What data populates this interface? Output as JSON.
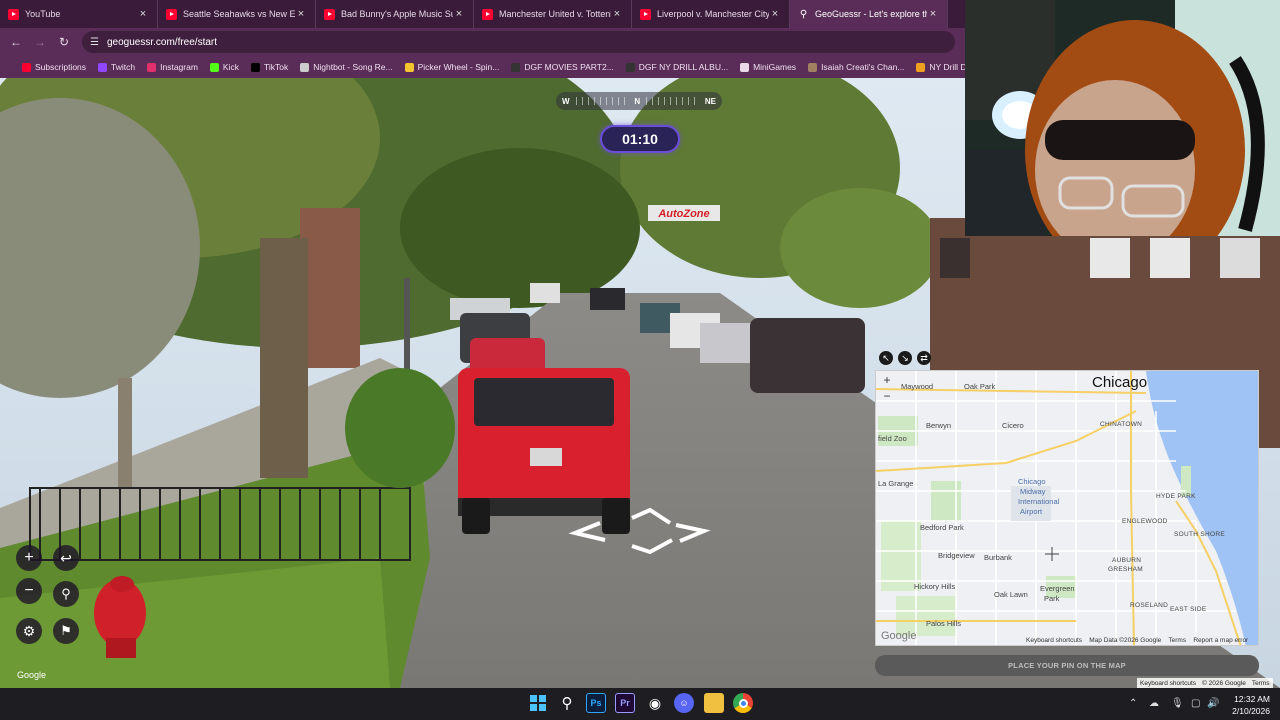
{
  "browser": {
    "tabs": [
      {
        "title": "YouTube",
        "icon": "youtube-icon"
      },
      {
        "title": "Seattle Seahawks vs New Engla",
        "icon": "youtube-icon"
      },
      {
        "title": "Bad Bunny's Apple Music Supe",
        "icon": "youtube-icon"
      },
      {
        "title": "Manchester United v. Tottenhai",
        "icon": "youtube-icon"
      },
      {
        "title": "Liverpool v. Manchester City | P",
        "icon": "youtube-icon"
      },
      {
        "title": "GeoGuessr - Let's explore the w",
        "icon": "geoguessr-icon",
        "active": true
      }
    ],
    "url": "geoguessr.com/free/start",
    "bookmarks": [
      {
        "label": "Subscriptions",
        "color": "#ff0033"
      },
      {
        "label": "Twitch",
        "color": "#9146ff"
      },
      {
        "label": "Instagram",
        "color": "#e1306c"
      },
      {
        "label": "Kick",
        "color": "#53fc18"
      },
      {
        "label": "TikTok",
        "color": "#000000"
      },
      {
        "label": "Nightbot - Song Re...",
        "color": "#cccccc"
      },
      {
        "label": "Picker Wheel - Spin...",
        "color": "#f4c430"
      },
      {
        "label": "DGF MOVIES PART2...",
        "color": "#333333"
      },
      {
        "label": "DGF NY DRILL ALBU...",
        "color": "#333333"
      },
      {
        "label": "MiniGames",
        "color": "#e8d8e8"
      },
      {
        "label": "Isaiah Creati's Chan...",
        "color": "#a08060"
      },
      {
        "label": "NY Drill Deads Qu",
        "color": "#f0a020"
      }
    ]
  },
  "game": {
    "compass": {
      "left": "W",
      "center": "N",
      "right": "NE"
    },
    "timer": "01:10",
    "place_pin_label": "PLACE YOUR PIN ON THE MAP",
    "street_google": "Google"
  },
  "map": {
    "city": "Chicago",
    "labels": [
      {
        "text": "Maywood"
      },
      {
        "text": "Oak Park"
      },
      {
        "text": "Berwyn"
      },
      {
        "text": "Cicero"
      },
      {
        "text": "CHINATOWN"
      },
      {
        "text": "field Zoo"
      },
      {
        "text": "La Grange"
      },
      {
        "text": "Chicago"
      },
      {
        "text": "Midway"
      },
      {
        "text": "International"
      },
      {
        "text": "Airport"
      },
      {
        "text": "HYDE PARK"
      },
      {
        "text": "Bedford Park"
      },
      {
        "text": "ENGLEWOOD"
      },
      {
        "text": "SOUTH SHORE"
      },
      {
        "text": "Bridgeview"
      },
      {
        "text": "Burbank"
      },
      {
        "text": "AUBURN"
      },
      {
        "text": "GRESHAM"
      },
      {
        "text": "Hickory Hills"
      },
      {
        "text": "Oak Lawn"
      },
      {
        "text": "Evergreen"
      },
      {
        "text": "Park"
      },
      {
        "text": "ROSELAND"
      },
      {
        "text": "EAST SIDE"
      },
      {
        "text": "Palos Hills"
      }
    ],
    "footer": {
      "shortcuts": "Keyboard shortcuts",
      "data": "Map Data ©2026 Google",
      "terms": "Terms",
      "report": "Report a map error"
    },
    "google": "Google"
  },
  "attribution": {
    "shortcuts": "Keyboard shortcuts",
    "data": "© 2026 Google",
    "terms": "Terms"
  },
  "taskbar": {
    "time": "12:32 AM",
    "date": "2/10/2026"
  }
}
